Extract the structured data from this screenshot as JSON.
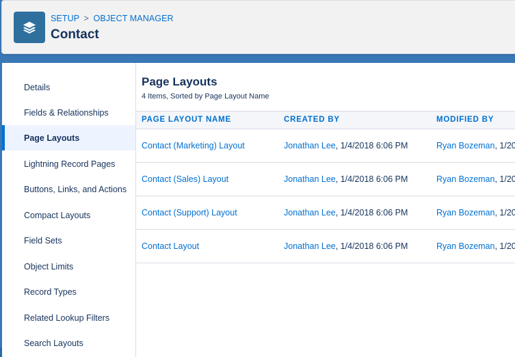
{
  "header": {
    "breadcrumb": [
      "SETUP",
      "OBJECT MANAGER"
    ],
    "breadcrumb_sep": ">",
    "title": "Contact",
    "icon": "layers-icon"
  },
  "sidebar": {
    "items": [
      {
        "label": "Details"
      },
      {
        "label": "Fields & Relationships"
      },
      {
        "label": "Page Layouts",
        "active": true
      },
      {
        "label": "Lightning Record Pages"
      },
      {
        "label": "Buttons, Links, and Actions"
      },
      {
        "label": "Compact Layouts"
      },
      {
        "label": "Field Sets"
      },
      {
        "label": "Object Limits"
      },
      {
        "label": "Record Types"
      },
      {
        "label": "Related Lookup Filters"
      },
      {
        "label": "Search Layouts"
      }
    ]
  },
  "content": {
    "title": "Page Layouts",
    "subtitle": "4 Items, Sorted by Page Layout Name",
    "columns": [
      "PAGE LAYOUT NAME",
      "CREATED BY",
      "MODIFIED BY"
    ],
    "rows": [
      {
        "name": "Contact (Marketing) Layout",
        "created_user": "Jonathan Lee",
        "created_date": ", 1/4/2018 6:06 PM",
        "modified_user": "Ryan Bozeman",
        "modified_date": ", 1/20"
      },
      {
        "name": "Contact (Sales) Layout",
        "created_user": "Jonathan Lee",
        "created_date": ", 1/4/2018 6:06 PM",
        "modified_user": "Ryan Bozeman",
        "modified_date": ", 1/20"
      },
      {
        "name": "Contact (Support) Layout",
        "created_user": "Jonathan Lee",
        "created_date": ", 1/4/2018 6:06 PM",
        "modified_user": "Ryan Bozeman",
        "modified_date": ", 1/20"
      },
      {
        "name": "Contact Layout",
        "created_user": "Jonathan Lee",
        "created_date": ", 1/4/2018 6:06 PM",
        "modified_user": "Ryan Bozeman",
        "modified_date": ", 1/20"
      }
    ]
  },
  "colors": {
    "link": "#0070d2",
    "text": "#16325c",
    "brand_icon": "#2e6f9e",
    "active_bg": "#eef4ff",
    "background": "#3a78b5"
  }
}
